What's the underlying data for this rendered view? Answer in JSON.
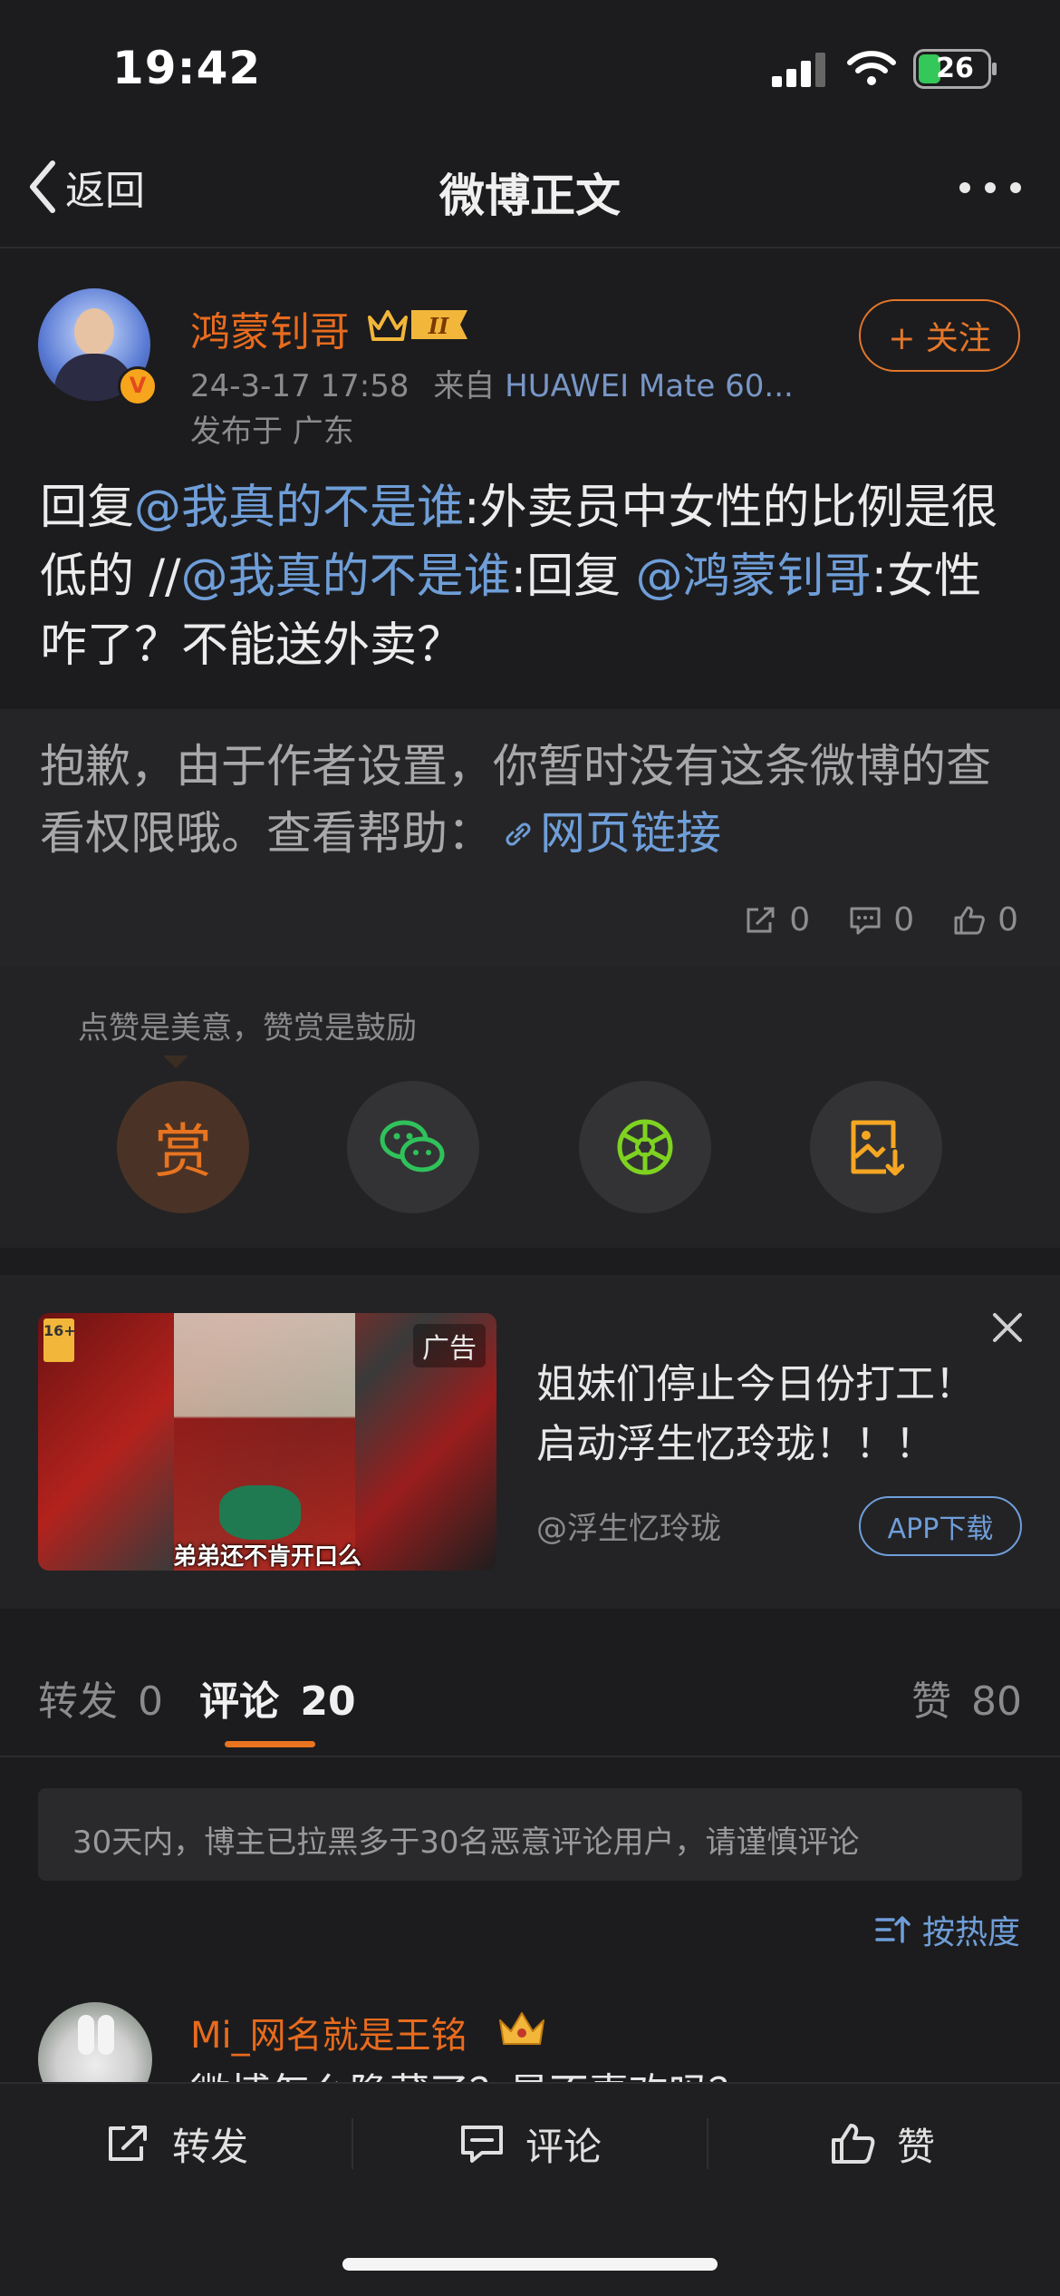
{
  "status_bar": {
    "time": "19:42",
    "battery": "26"
  },
  "header": {
    "back_label": "返回",
    "title": "微博正文"
  },
  "author": {
    "name": "鸿蒙钊哥",
    "date": "24-3-17 17:58",
    "source_prefix": "来自",
    "device": "HUAWEI Mate 60...",
    "location": "发布于 广东",
    "follow_label": "+ 关注",
    "level_badge": "II",
    "verified": "V"
  },
  "post": {
    "parts": [
      {
        "text": "回复",
        "mention": false
      },
      {
        "text": "@我真的不是谁",
        "mention": true
      },
      {
        "text": ":外卖员中女性的比例是很低的 //",
        "mention": false
      },
      {
        "text": "@我真的不是谁",
        "mention": true
      },
      {
        "text": ":回复 ",
        "mention": false
      },
      {
        "text": "@鸿蒙钊哥",
        "mention": true
      },
      {
        "text": ":女性咋了？不能送外卖？",
        "mention": false
      }
    ]
  },
  "restricted": {
    "text": "抱歉，由于作者设置，你暂时没有这条微博的查看权限哦。查看帮助：",
    "link_label": "网页链接"
  },
  "stats": {
    "reposts": "0",
    "comments": "0",
    "likes": "0"
  },
  "reward": {
    "tip": "点赞是美意，赞赏是鼓励",
    "reward_label": "赏",
    "icons": {
      "wechat": "wechat-icon",
      "moments": "moments-icon",
      "save": "save-image-icon"
    }
  },
  "ad": {
    "tag": "广告",
    "age": "16+",
    "caption": "弟弟还不肯开口么",
    "title": "姐妹们停止今日份打工！启动浮生忆玲珑！！！",
    "source": "@浮生忆玲珑",
    "cta": "APP下载"
  },
  "tabs": {
    "repost_label": "转发",
    "repost_count": "0",
    "comment_label": "评论",
    "comment_count": "20",
    "like_label": "赞",
    "like_count": "80"
  },
  "notice": "30天内，博主已拉黑多于30名恶意评论用户，请谨慎评论",
  "sort_label": "按热度",
  "comment": {
    "user": "Mi_网名就是王铭",
    "text": "微博怎么隐藏了？是不喜欢吗？"
  },
  "bottom_bar": {
    "repost": "转发",
    "comment": "评论",
    "like": "赞"
  },
  "colors": {
    "accent": "#e8741f",
    "link": "#6f9ed8",
    "background": "#1c1c1e"
  }
}
